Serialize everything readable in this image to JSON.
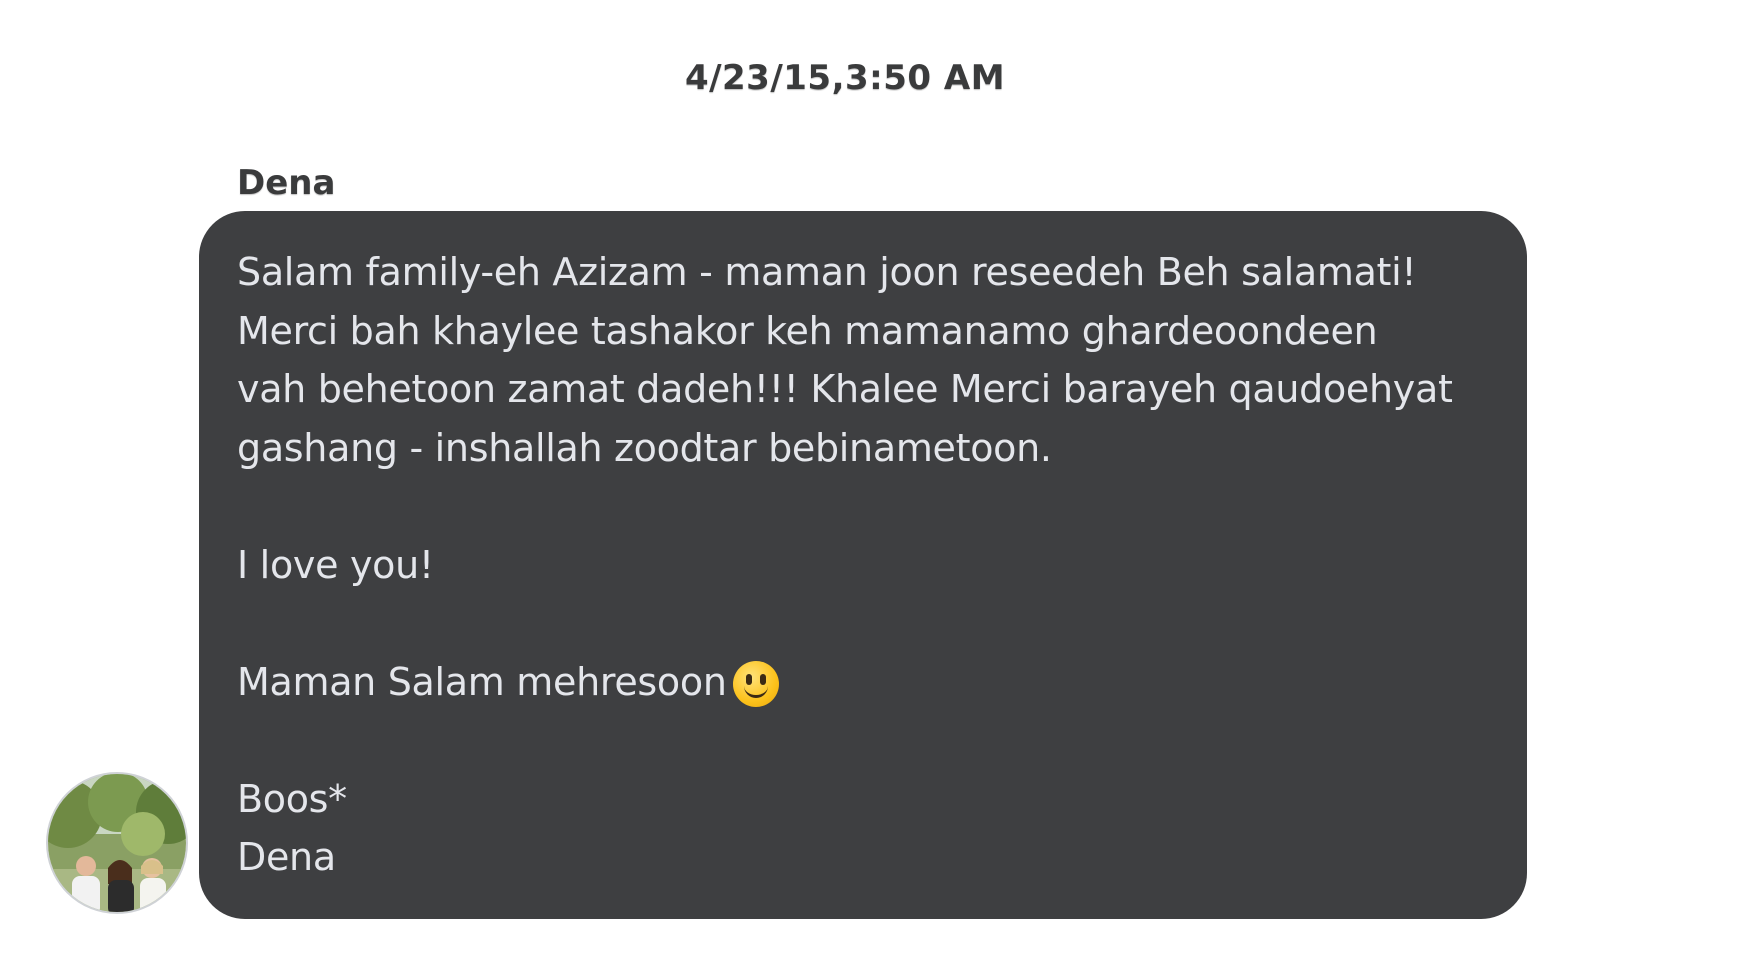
{
  "conversation": {
    "timestamp": "4/23/15,3:50 AM",
    "sender_name": "Dena",
    "message": {
      "lines": [
        "Salam family-eh Azizam - maman joon reseedeh Beh salamati!",
        "Merci bah khaylee tashakor keh mamanamo ghardeoondeen",
        "vah behetoon zamat dadeh!!! Khalee Merci barayeh qaudoehyat",
        "gashang - inshallah zoodtar bebinametoon.",
        "",
        "I love you!",
        "",
        "Maman Salam mehresoon",
        "",
        "Boos*",
        "Dena"
      ],
      "emoji": "slightly-smiling-face-icon"
    },
    "bubble_color": "#3e3f41",
    "text_color": "#e4e6eb"
  }
}
